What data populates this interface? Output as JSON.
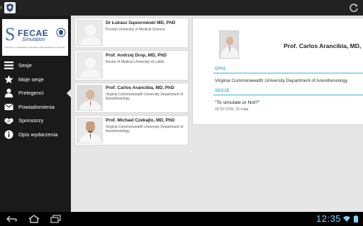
{
  "statusbar": {
    "time": "12:35"
  },
  "brand": {
    "s": "S",
    "fecae": "FECAE",
    "simulation": "Simulation",
    "subtitle": "The Forum of Education Cooperation and Assessment in Europe"
  },
  "nav": [
    {
      "label": "Sesje",
      "icon": "menu-icon"
    },
    {
      "label": "Moje sesje",
      "icon": "star-icon"
    },
    {
      "label": "Prelegenci",
      "icon": "person-icon",
      "active": true
    },
    {
      "label": "Powiadomienia",
      "icon": "mail-icon"
    },
    {
      "label": "Sponsorzy",
      "icon": "handshake-icon"
    },
    {
      "label": "Opis wydarzenia",
      "icon": "info-icon"
    }
  ],
  "speakers": [
    {
      "name": "Dr Łukasz Gąsiorowski MD, PhD",
      "affiliation": "Poznan University of Medical Science",
      "photo": "placeholder"
    },
    {
      "name": "Prof. Andrzej Drop, MD, PhD",
      "affiliation": "Rector of Medical University of Lublin",
      "photo": "placeholder"
    },
    {
      "name": "Prof. Carlos Arancibia, MD, PhD",
      "affiliation": "Virginia Commonwealth University Department of Anesthesiology",
      "photo": "portrait"
    },
    {
      "name": "Prof. Michael Czekajlo, MD, PhD",
      "affiliation": "Virginia Commonwealth University Department of Anesthesiology",
      "photo": "portrait"
    }
  ],
  "detail": {
    "name": "Prof. Carlos Arancibia, MD, Ph",
    "opis_label": "OPIS",
    "opis_text": "Virginia Commonwealth University Department of Anesthesiology",
    "sesje_label": "SESJE",
    "session_title": "\"To simulate or Not?\"",
    "session_time": "18:10-19:00, 16 maja"
  },
  "colors": {
    "accent": "#33b5e5",
    "clock": "#7fd4ff",
    "brand_blue": "#2e4f86"
  }
}
